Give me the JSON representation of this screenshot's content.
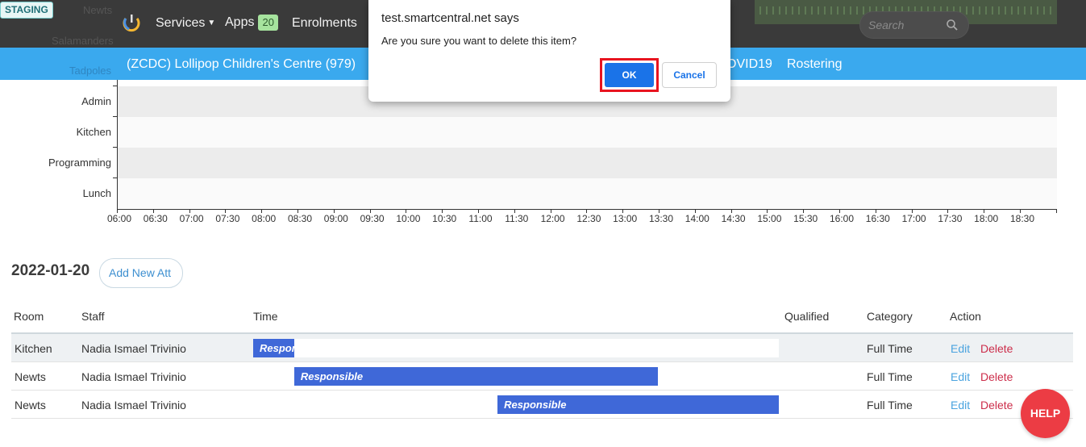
{
  "env_badge": "STAGING",
  "ghost_labels": [
    "Newts",
    "Salamanders",
    "Tadpoles"
  ],
  "nav": {
    "services": "Services",
    "apps": "Apps",
    "apps_count": "20",
    "enrolments": "Enrolments"
  },
  "search": {
    "placeholder": "Search"
  },
  "subnav": {
    "centre": "(ZCDC) Lollipop Children's Centre (979)",
    "covid": "OVID19",
    "rostering": "Rostering"
  },
  "timeline": {
    "rows": [
      "Admin",
      "Kitchen",
      "Programming",
      "Lunch"
    ],
    "times": [
      "06:00",
      "06:30",
      "07:00",
      "07:30",
      "08:00",
      "08:30",
      "09:00",
      "09:30",
      "10:00",
      "10:30",
      "11:00",
      "11:30",
      "12:00",
      "12:30",
      "13:00",
      "13:30",
      "14:00",
      "14:30",
      "15:00",
      "15:30",
      "16:00",
      "16:30",
      "17:00",
      "17:30",
      "18:00",
      "18:30"
    ]
  },
  "attendance": {
    "date": "2022-01-20",
    "add_button": "Add New Att",
    "headers": {
      "room": "Room",
      "staff": "Staff",
      "time": "Time",
      "qualified": "Qualified",
      "category": "Category",
      "action": "Action"
    },
    "rows": [
      {
        "room": "Kitchen",
        "staff": "Nadia Ismael Trivinio",
        "bar_label": "Responsible",
        "bar_start": 0.0,
        "bar_end": 0.078,
        "category": "Full Time",
        "edit": "Edit",
        "delete": "Delete"
      },
      {
        "room": "Newts",
        "staff": "Nadia Ismael Trivinio",
        "bar_label": "Responsible",
        "bar_start": 0.078,
        "bar_end": 0.77,
        "category": "Full Time",
        "edit": "Edit",
        "delete": "Delete"
      },
      {
        "room": "Newts",
        "staff": "Nadia Ismael Trivinio",
        "bar_label": "Responsible",
        "bar_start": 0.465,
        "bar_end": 1.0,
        "category": "Full Time",
        "edit": "Edit",
        "delete": "Delete"
      }
    ]
  },
  "dialog": {
    "title": "test.smartcentral.net says",
    "message": "Are you sure you want to delete this item?",
    "ok": "OK",
    "cancel": "Cancel"
  },
  "help": "HELP",
  "colors": {
    "topbar": "#3a3a3a",
    "subbar": "#3aa9ee",
    "bar": "#3f68d8",
    "ok": "#1a73e8",
    "highlight": "#e8141f",
    "help": "#ec3c44"
  }
}
